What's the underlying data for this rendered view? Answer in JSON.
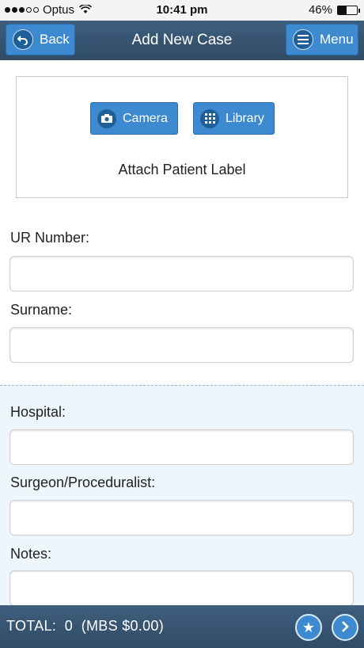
{
  "status_bar": {
    "carrier": "Optus",
    "time": "10:41 pm",
    "battery": "46%",
    "battery_level": 0.46,
    "signal_bars_filled": 3,
    "signal_bars_total": 5
  },
  "nav": {
    "back_label": "Back",
    "title": "Add New Case",
    "menu_label": "Menu"
  },
  "attach": {
    "camera_label": "Camera",
    "library_label": "Library",
    "label": "Attach Patient Label"
  },
  "form": {
    "ur_number": {
      "label": "UR Number:",
      "value": ""
    },
    "surname": {
      "label": "Surname:",
      "value": ""
    },
    "hospital": {
      "label": "Hospital:",
      "value": ""
    },
    "surgeon": {
      "label": "Surgeon/Proceduralist:",
      "value": ""
    },
    "notes": {
      "label": "Notes:",
      "value": ""
    }
  },
  "footer": {
    "total_label": "TOTAL:",
    "total_value": "0",
    "mbs": "(MBS $0.00)"
  },
  "colors": {
    "nav_bg": "#35536f",
    "button_blue": "#3d8ad0",
    "lower_section_bg": "#eef6fd"
  },
  "icons": {
    "back": "back-arrow-icon",
    "menu": "hamburger-icon",
    "camera": "camera-icon",
    "library": "grid-icon",
    "favorite": "star-icon",
    "next": "chevron-right-icon"
  }
}
